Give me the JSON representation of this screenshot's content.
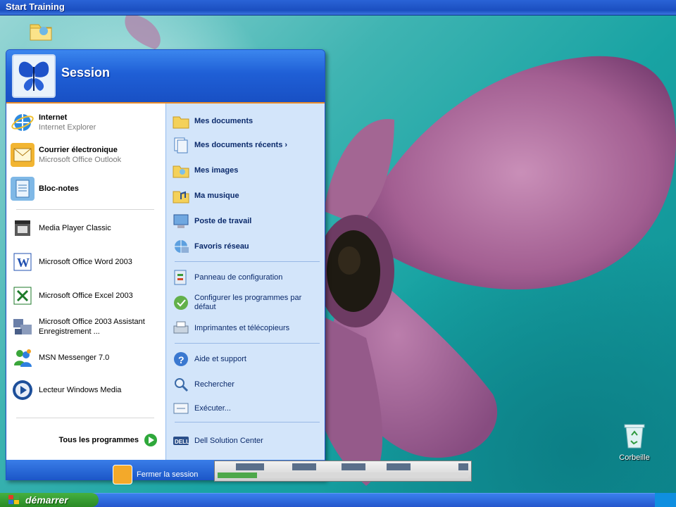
{
  "window": {
    "title": "Start Training"
  },
  "desktop": {
    "icons": [
      {
        "name": "folder-icon",
        "label": ""
      },
      {
        "name": "recycle-bin-icon",
        "label": "Corbeille"
      }
    ]
  },
  "start_menu": {
    "user": "Session",
    "pinned": [
      {
        "title": "Internet",
        "subtitle": "Internet Explorer",
        "icon": "internet-explorer-icon"
      },
      {
        "title": "Courrier électronique",
        "subtitle": "Microsoft Office Outlook",
        "icon": "outlook-icon"
      },
      {
        "title": "Bloc-notes",
        "subtitle": "",
        "icon": "notepad-icon"
      }
    ],
    "recent": [
      {
        "title": "Media Player Classic",
        "icon": "media-player-classic-icon"
      },
      {
        "title": "Microsoft Office Word 2003",
        "icon": "word-icon"
      },
      {
        "title": "Microsoft Office Excel 2003",
        "icon": "excel-icon"
      },
      {
        "title": "Microsoft Office 2003 Assistant Enregistrement ...",
        "icon": "office-assistant-icon"
      },
      {
        "title": "MSN Messenger 7.0",
        "icon": "msn-messenger-icon"
      },
      {
        "title": "Lecteur Windows Media",
        "icon": "windows-media-icon"
      }
    ],
    "all_programs": "Tous les programmes",
    "places": [
      {
        "title": "Mes documents",
        "icon": "folder-icon",
        "bold": true
      },
      {
        "title": "Mes documents récents ›",
        "icon": "recent-docs-icon",
        "bold": true
      },
      {
        "title": "Mes images",
        "icon": "pictures-folder-icon",
        "bold": true
      },
      {
        "title": "Ma musique",
        "icon": "music-folder-icon",
        "bold": true
      },
      {
        "title": "Poste de travail",
        "icon": "computer-icon",
        "bold": true
      },
      {
        "title": "Favoris réseau",
        "icon": "network-icon",
        "bold": true
      }
    ],
    "system": [
      {
        "title": "Panneau de configuration",
        "icon": "control-panel-icon"
      },
      {
        "title": "Configurer les programmes par défaut",
        "icon": "default-programs-icon"
      },
      {
        "title": "Imprimantes et télécopieurs",
        "icon": "printers-icon"
      }
    ],
    "help": [
      {
        "title": "Aide et support",
        "icon": "help-icon"
      },
      {
        "title": "Rechercher",
        "icon": "search-icon"
      },
      {
        "title": "Exécuter...",
        "icon": "run-icon"
      }
    ],
    "extra": [
      {
        "title": "Dell Solution Center",
        "icon": "dell-icon"
      }
    ],
    "logoff": "Fermer la session"
  },
  "taskbar": {
    "start_label": "démarrer"
  },
  "colors": {
    "menu_blue": "#1f5fd6",
    "right_panel": "#d3e5fa",
    "accent_orange": "#e98c2a",
    "start_green": "#2a8a26"
  }
}
